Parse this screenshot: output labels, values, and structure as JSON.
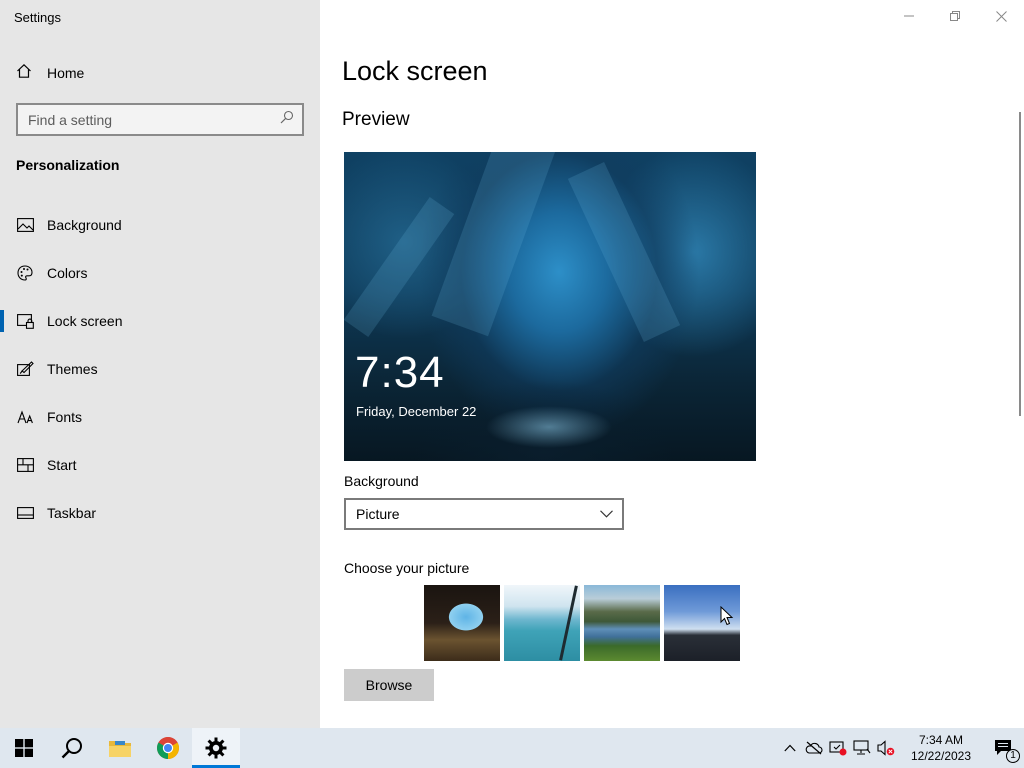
{
  "window": {
    "title": "Settings"
  },
  "sidebar": {
    "home_label": "Home",
    "search_placeholder": "Find a setting",
    "section_title": "Personalization",
    "items": [
      {
        "label": "Background",
        "icon": "picture-icon"
      },
      {
        "label": "Colors",
        "icon": "palette-icon"
      },
      {
        "label": "Lock screen",
        "icon": "lock-screen-icon",
        "active": true
      },
      {
        "label": "Themes",
        "icon": "themes-icon"
      },
      {
        "label": "Fonts",
        "icon": "fonts-icon"
      },
      {
        "label": "Start",
        "icon": "start-icon"
      },
      {
        "label": "Taskbar",
        "icon": "taskbar-icon"
      }
    ]
  },
  "main": {
    "page_title": "Lock screen",
    "preview_title": "Preview",
    "preview": {
      "time": "7:34",
      "date": "Friday, December 22"
    },
    "background_label": "Background",
    "background_value": "Picture",
    "choose_label": "Choose your picture",
    "browse_label": "Browse"
  },
  "taskbar": {
    "time": "7:34 AM",
    "date": "12/22/2023",
    "notification_count": "1"
  },
  "colors": {
    "accent": "#0078d7",
    "sidebar_bg": "#e6e6e6",
    "taskbar_bg": "#dfe7ef"
  }
}
